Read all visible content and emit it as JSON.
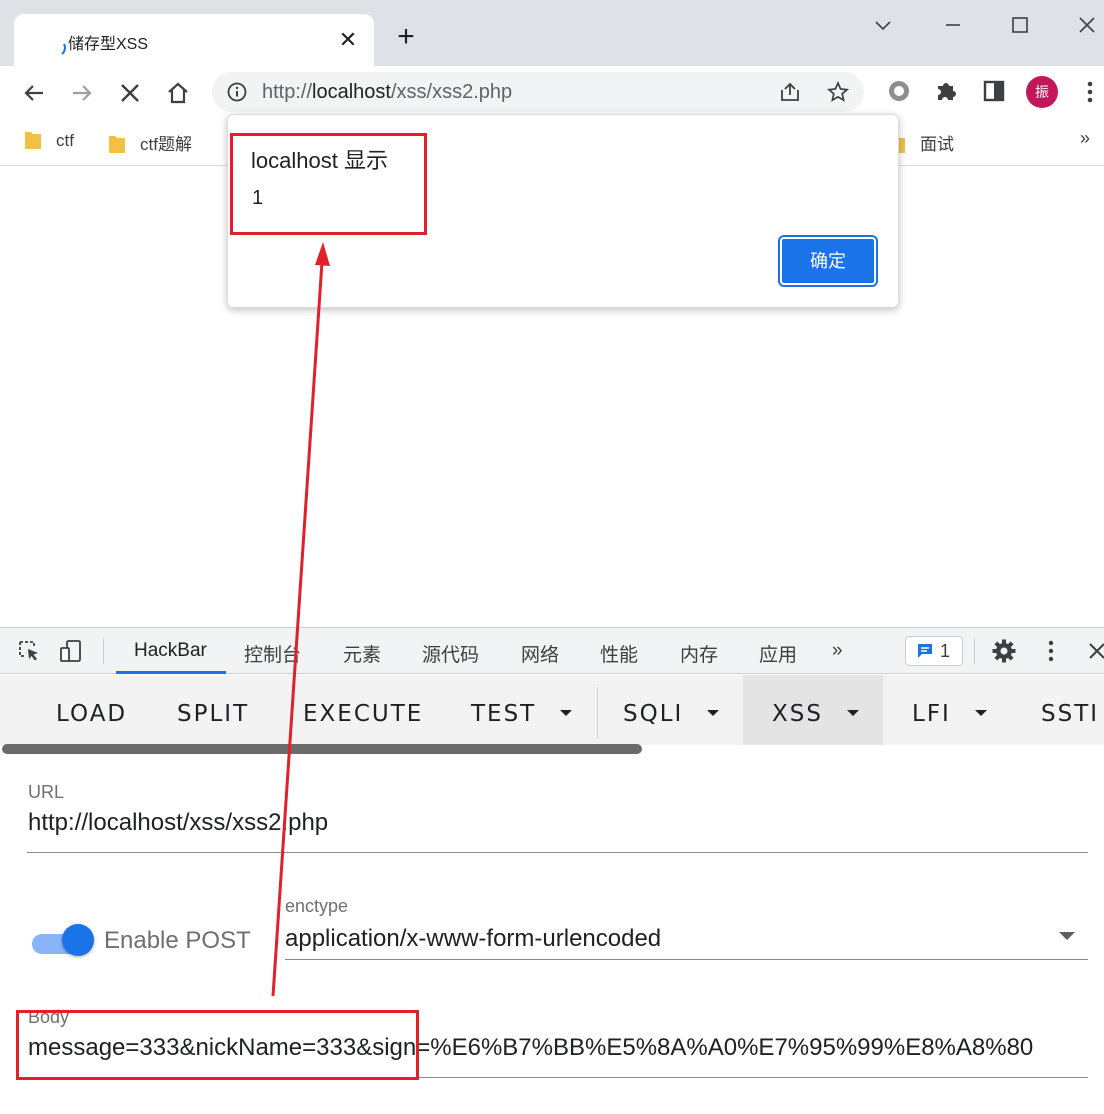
{
  "browser": {
    "tab_title": "储存型XSS",
    "url_scheme_prefix": "http://",
    "url_host": "localhost",
    "url_path": "/xss/xss2.php",
    "profile_initial": "振",
    "bookmarks": [
      "ctf",
      "ctf题解",
      "面试"
    ],
    "bookmarks_more": "»"
  },
  "dialog": {
    "title": "localhost 显示",
    "message": "1",
    "ok_label": "确定"
  },
  "devtools": {
    "tabs": [
      "HackBar",
      "控制台",
      "元素",
      "源代码",
      "网络",
      "性能",
      "内存",
      "应用"
    ],
    "more": "»",
    "issues_count": "1"
  },
  "hackbar": {
    "buttons": [
      "LOAD",
      "SPLIT",
      "EXECUTE",
      "TEST",
      "SQLI",
      "XSS",
      "LFI",
      "SSTI"
    ],
    "url_label": "URL",
    "url_value": "http://localhost/xss/xss2.php",
    "enable_post_label": "Enable POST",
    "enable_post_on": true,
    "enctype_label": "enctype",
    "enctype_value": "application/x-www-form-urlencoded",
    "body_label": "Body",
    "body_value": "message=333&nickName=333&sign=%E6%B7%BB%E5%8A%A0%E7%95%99%E8%A8%80"
  },
  "colors": {
    "accent": "#1a73e8",
    "annotation": "#e0202a"
  }
}
